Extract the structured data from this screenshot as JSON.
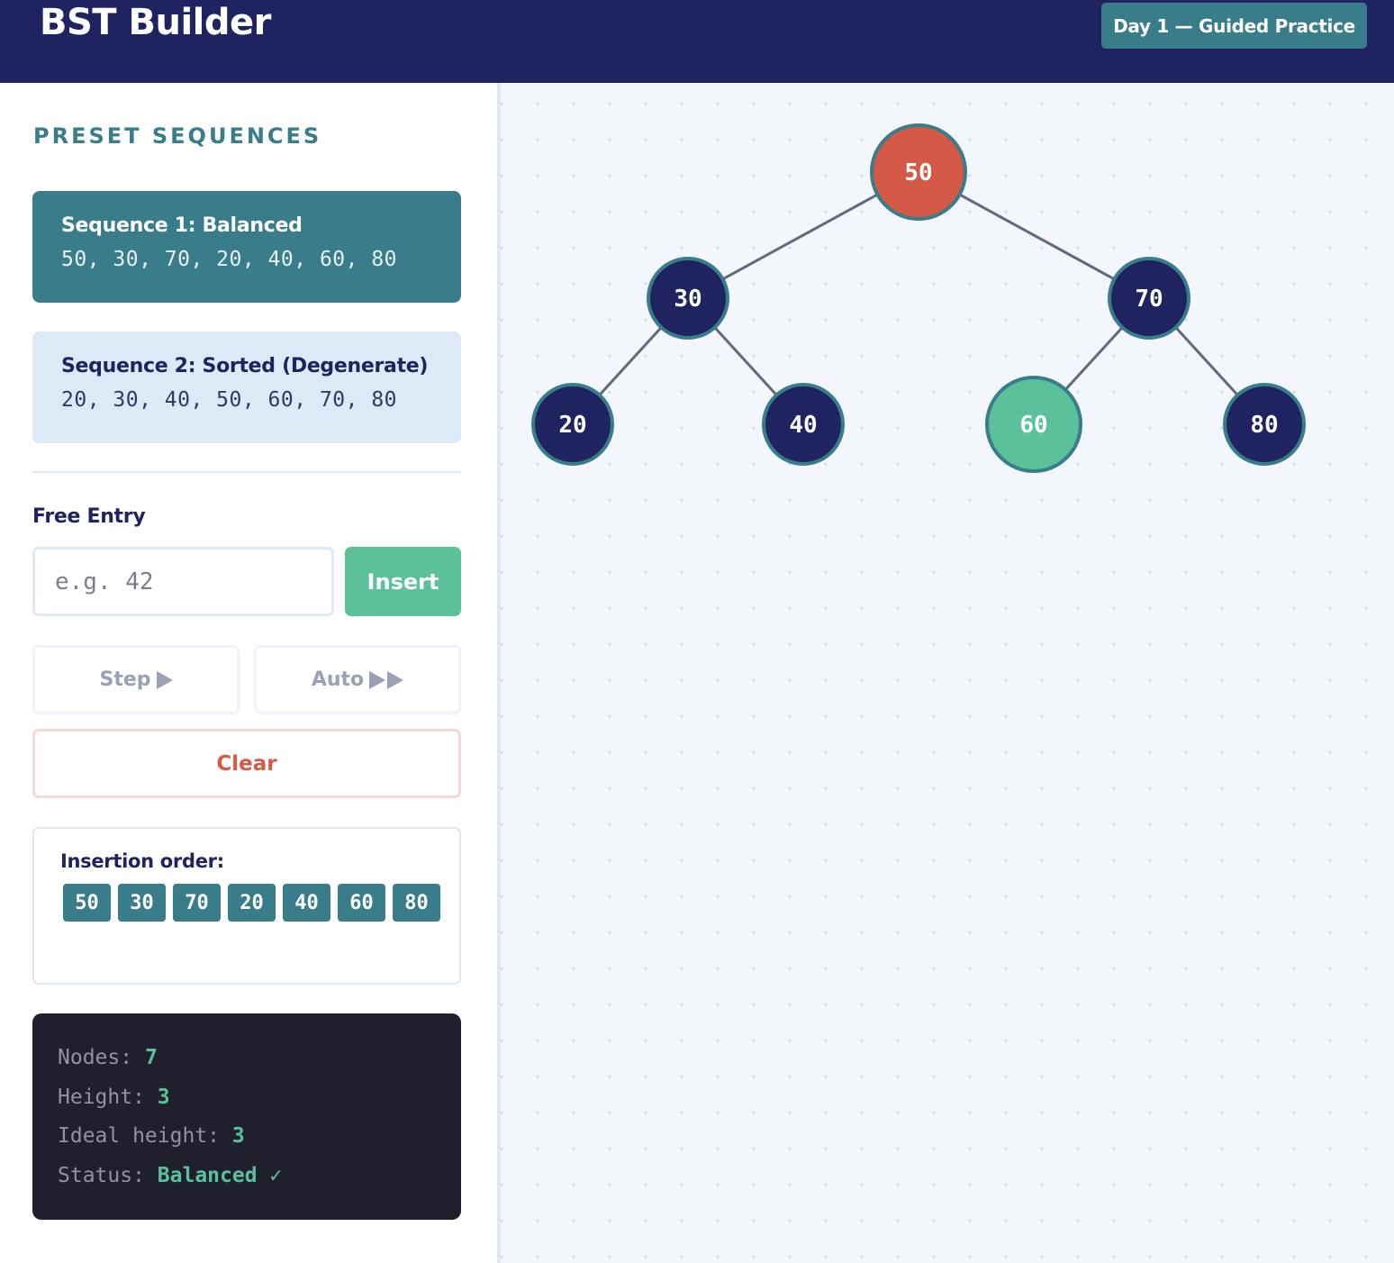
{
  "header": {
    "title": "BST Builder",
    "badge": "Day 1 — Guided Practice"
  },
  "sidebar": {
    "section_title": "PRESET SEQUENCES",
    "sequences": [
      {
        "name": "Sequence 1: Balanced",
        "values": "50, 30, 70, 20, 40, 60, 80",
        "active": true
      },
      {
        "name": "Sequence 2: Sorted (Degenerate)",
        "values": "20, 30, 40, 50, 60, 70, 80",
        "active": false
      }
    ],
    "free_entry": {
      "label": "Free Entry",
      "placeholder": "e.g. 42",
      "value": "",
      "insert_label": "Insert"
    },
    "step_label": "Step",
    "auto_label": "Auto",
    "clear_label": "Clear",
    "insertion_order": {
      "label": "Insertion order:",
      "values": [
        "50",
        "30",
        "70",
        "20",
        "40",
        "60",
        "80"
      ]
    },
    "stats": {
      "nodes_label": "Nodes:",
      "nodes": "7",
      "height_label": "Height:",
      "height": "3",
      "ideal_label": "Ideal height:",
      "ideal": "3",
      "status_label": "Status:",
      "status": "Balanced ✓"
    }
  },
  "tree": {
    "nodes": [
      {
        "value": "50",
        "state": "root-highlight"
      },
      {
        "value": "30",
        "state": "normal"
      },
      {
        "value": "70",
        "state": "normal"
      },
      {
        "value": "20",
        "state": "normal"
      },
      {
        "value": "40",
        "state": "normal"
      },
      {
        "value": "60",
        "state": "just-inserted"
      },
      {
        "value": "80",
        "state": "normal"
      }
    ],
    "edges": [
      [
        "50",
        "30"
      ],
      [
        "50",
        "70"
      ],
      [
        "30",
        "20"
      ],
      [
        "30",
        "40"
      ],
      [
        "70",
        "60"
      ],
      [
        "70",
        "80"
      ]
    ]
  },
  "colors": {
    "header_bg": "#1f2460",
    "accent_teal": "#3a7d8a",
    "success_green": "#5ac19a",
    "danger_red": "#d45a47",
    "node_dark": "#1f2460",
    "stats_bg": "#1f1f2e"
  }
}
